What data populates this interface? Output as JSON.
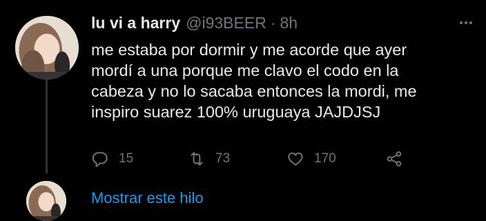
{
  "tweet": {
    "display_name": "lu vi a harry",
    "handle": "@i93BEER",
    "separator": "·",
    "time": "8h",
    "text_lines": [
      "me estaba por dormir y me acorde que ayer",
      "mordí a una porque me clavo el codo en la",
      "cabeza y no lo sacaba entonces la mordi, me",
      "inspiro suarez 100% uruguaya JAJDJSJ"
    ],
    "actions": {
      "reply_count": "15",
      "retweet_count": "73",
      "like_count": "170"
    },
    "icons": {
      "more": "more-icon",
      "reply": "reply-icon",
      "retweet": "retweet-icon",
      "like": "heart-icon",
      "share": "share-icon"
    }
  },
  "thread": {
    "show_thread_label": "Mostrar este hilo"
  },
  "colors": {
    "background": "#000000",
    "text": "#e7e9ea",
    "secondary": "#71767b",
    "link": "#1d9bf0",
    "thread_line": "#2f3336"
  }
}
